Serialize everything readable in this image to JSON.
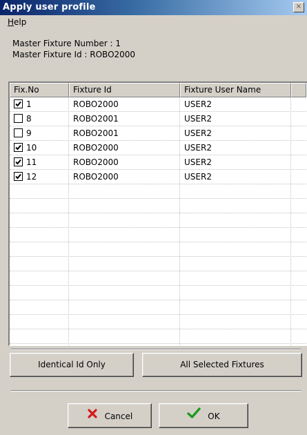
{
  "window": {
    "title": "Apply user profile",
    "close_glyph": "×"
  },
  "menu": {
    "help": "Help"
  },
  "info": {
    "master_number": "Master Fixture Number : 1",
    "master_id": "Master Fixture Id : ROBO2000"
  },
  "table": {
    "columns": [
      "Fix.No",
      "Fixture Id",
      "Fixture User Name"
    ],
    "rows": [
      {
        "checked": true,
        "fix_no": "1",
        "fixture_id": "ROBO2000",
        "user_name": "USER2"
      },
      {
        "checked": false,
        "fix_no": "8",
        "fixture_id": "ROBO2001",
        "user_name": "USER2"
      },
      {
        "checked": false,
        "fix_no": "9",
        "fixture_id": "ROBO2001",
        "user_name": "USER2"
      },
      {
        "checked": true,
        "fix_no": "10",
        "fixture_id": "ROBO2000",
        "user_name": "USER2"
      },
      {
        "checked": true,
        "fix_no": "11",
        "fixture_id": "ROBO2000",
        "user_name": "USER2"
      },
      {
        "checked": true,
        "fix_no": "12",
        "fixture_id": "ROBO2000",
        "user_name": "USER2"
      }
    ]
  },
  "buttons": {
    "identical": "Identical Id Only",
    "all_selected": "All Selected Fixtures",
    "cancel": "Cancel",
    "ok": "OK"
  },
  "icons": {
    "cancel": "red-x-icon",
    "ok": "green-check-icon"
  },
  "colors": {
    "title_start": "#0a246a",
    "title_end": "#a6caf0",
    "cancel_icon": "#d41a1a",
    "ok_icon": "#1f9a1f"
  }
}
